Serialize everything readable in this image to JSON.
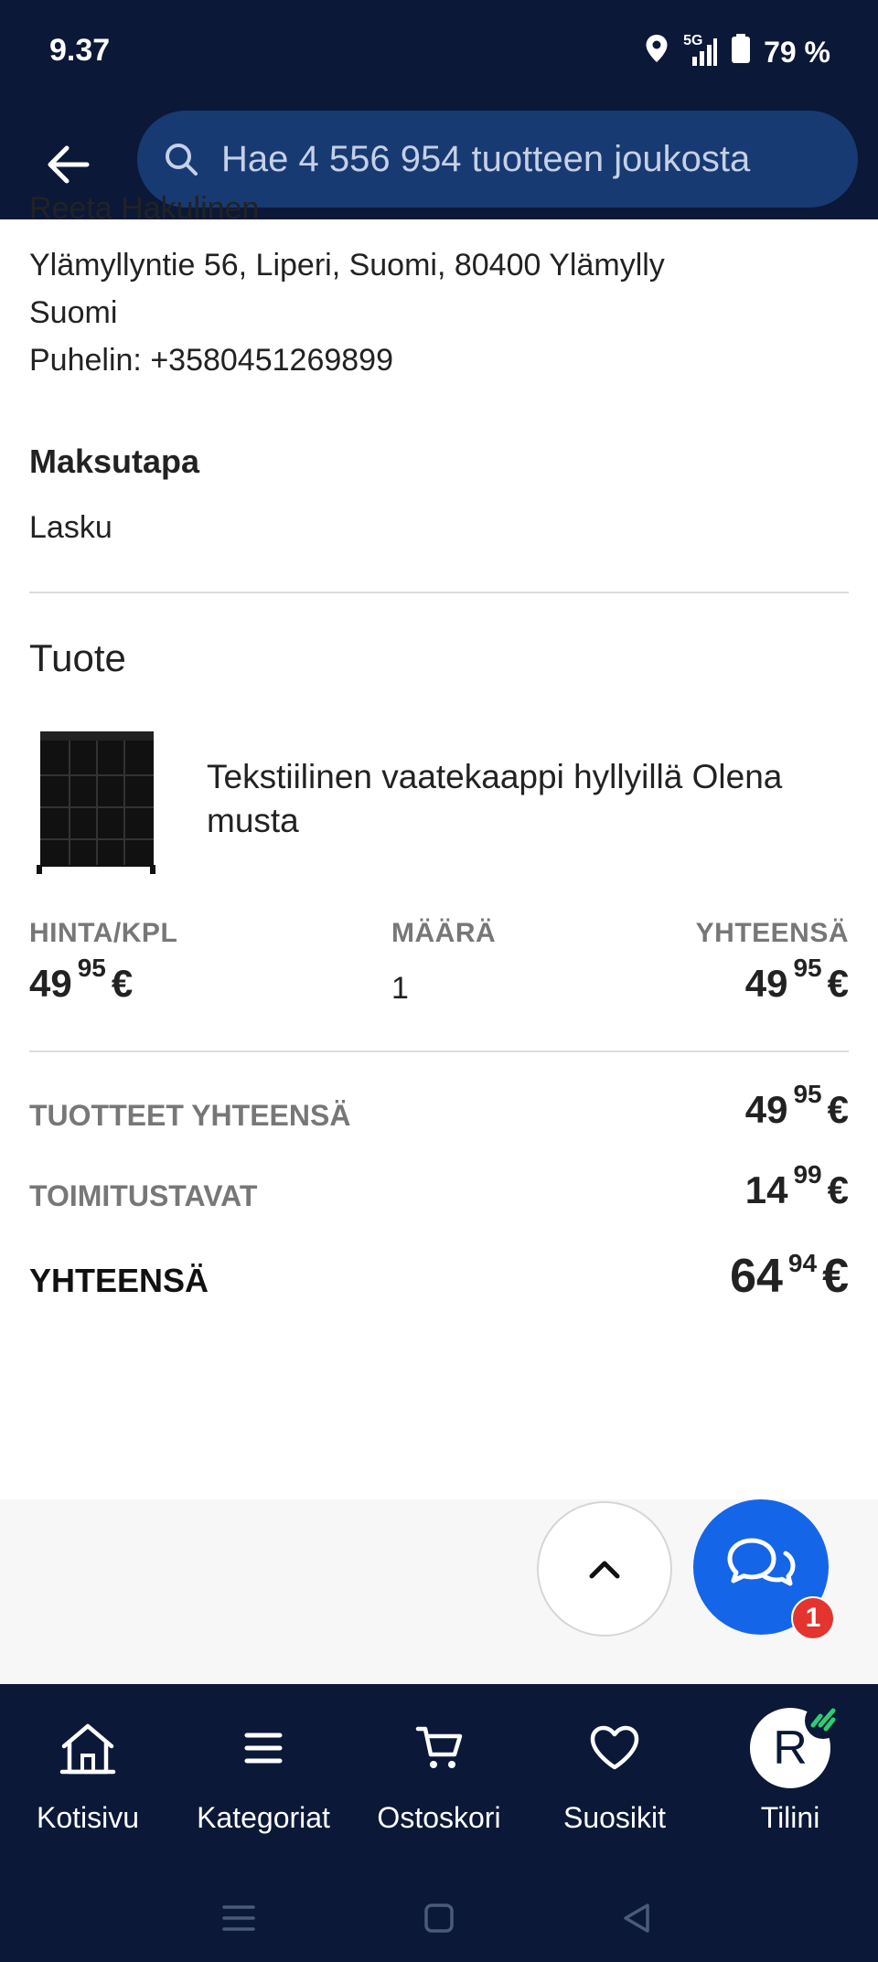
{
  "status_bar": {
    "time": "9.37",
    "network": "5G",
    "battery": "79 %"
  },
  "search": {
    "placeholder": "Hae 4 556 954 tuotteen joukosta"
  },
  "address": {
    "name_partial": "Reeta Hakulinen",
    "street": "Ylämyllyntie 56, Liperi, Suomi, 80400 Ylämylly",
    "country": "Suomi",
    "phone": "Puhelin: +3580451269899"
  },
  "payment": {
    "title": "Maksutapa",
    "method": "Lasku"
  },
  "product_section": {
    "title": "Tuote",
    "product_name": "Tekstiilinen vaatekaappi hyllyillä Olena musta",
    "headers": {
      "unit_price": "HINTA/KPL",
      "quantity": "MÄÄRÄ",
      "total": "YHTEENSÄ"
    },
    "unit_price": {
      "int": "49",
      "dec": "95",
      "cur": "€"
    },
    "quantity": "1",
    "line_total": {
      "int": "49",
      "dec": "95",
      "cur": "€"
    }
  },
  "summary": {
    "products_total_label": "TUOTTEET YHTEENSÄ",
    "products_total": {
      "int": "49",
      "dec": "95",
      "cur": "€"
    },
    "shipping_label": "TOIMITUSTAVAT",
    "shipping": {
      "int": "14",
      "dec": "99",
      "cur": "€"
    },
    "grand_total_label": "YHTEENSÄ",
    "grand_total": {
      "int": "64",
      "dec": "94",
      "cur": "€"
    }
  },
  "chat": {
    "badge": "1"
  },
  "tabs": [
    {
      "label": "Kotisivu",
      "icon": "home-icon"
    },
    {
      "label": "Kategoriat",
      "icon": "menu-icon"
    },
    {
      "label": "Ostoskori",
      "icon": "cart-icon"
    },
    {
      "label": "Suosikit",
      "icon": "heart-icon"
    },
    {
      "label": "Tilini",
      "icon": "avatar",
      "avatar_letter": "R"
    }
  ],
  "colors": {
    "header_bg": "#0b1838",
    "search_bg": "#173a72",
    "chat_blue": "#1565e8",
    "badge_red": "#e3342f",
    "accent_green": "#2ecc71"
  }
}
